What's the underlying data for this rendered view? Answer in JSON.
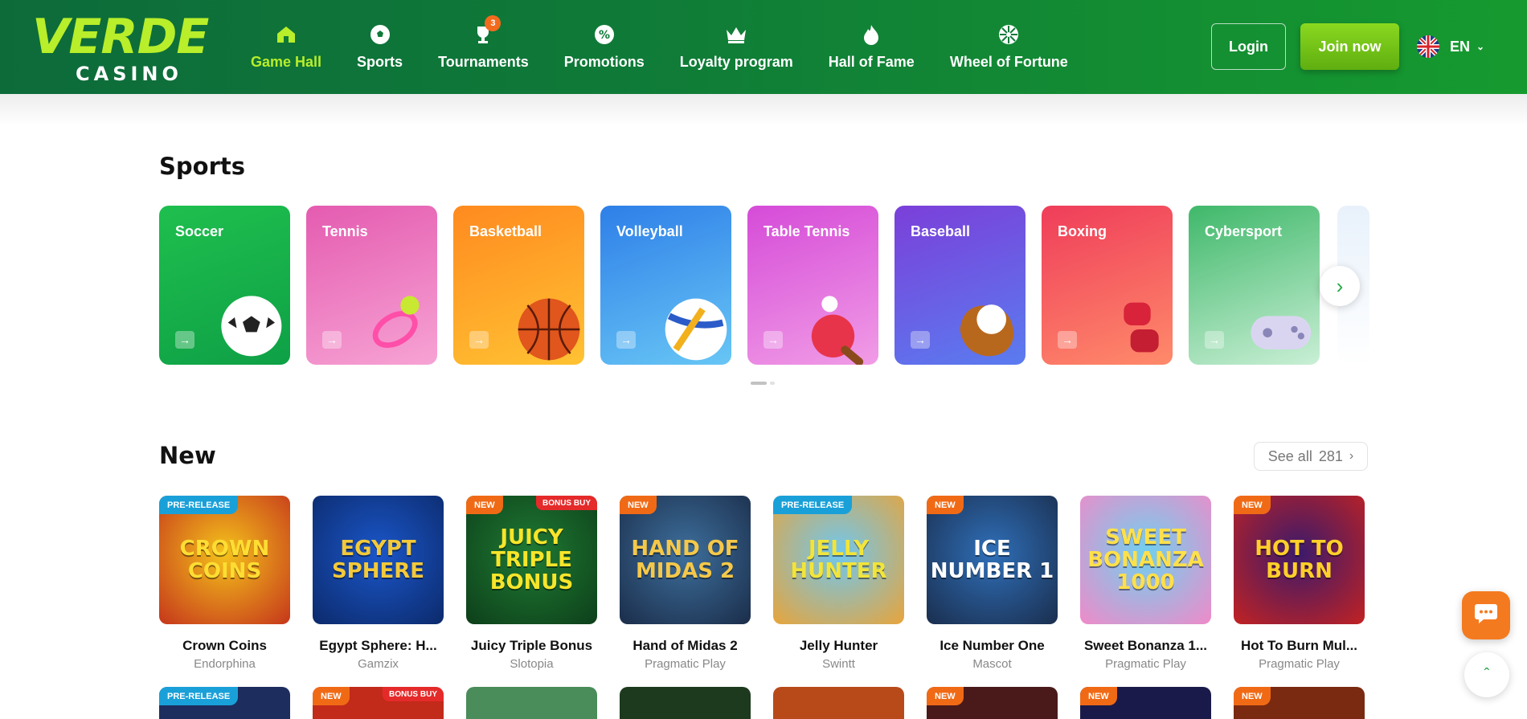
{
  "brand": {
    "name_top": "VERDE",
    "name_bottom": "CASINO"
  },
  "nav": [
    {
      "label": "Game Hall",
      "icon": "home-icon",
      "active": true
    },
    {
      "label": "Sports",
      "icon": "soccer-ball-icon"
    },
    {
      "label": "Tournaments",
      "icon": "trophy-icon",
      "badge": "3"
    },
    {
      "label": "Promotions",
      "icon": "percent-badge-icon"
    },
    {
      "label": "Loyalty program",
      "icon": "crown-icon"
    },
    {
      "label": "Hall of Fame",
      "icon": "flame-icon"
    },
    {
      "label": "Wheel of Fortune",
      "icon": "wheel-icon"
    }
  ],
  "header": {
    "login": "Login",
    "join": "Join now",
    "lang": "EN"
  },
  "sports": {
    "title": "Sports",
    "items": [
      {
        "label": "Soccer",
        "color_from": "#1fbf4e",
        "color_to": "#0ea046"
      },
      {
        "label": "Tennis",
        "color_from": "#e45bb0",
        "color_to": "#f7a3d4"
      },
      {
        "label": "Basketball",
        "color_from": "#ff8a1f",
        "color_to": "#ffc233"
      },
      {
        "label": "Volleyball",
        "color_from": "#2e7fe8",
        "color_to": "#68c6f5"
      },
      {
        "label": "Table Tennis",
        "color_from": "#d54bd8",
        "color_to": "#f19ce6"
      },
      {
        "label": "Baseball",
        "color_from": "#7b3fd9",
        "color_to": "#5a7cf0"
      },
      {
        "label": "Boxing",
        "color_from": "#ef3d5a",
        "color_to": "#ff8a6a"
      },
      {
        "label": "Cybersport",
        "color_from": "#3fb86a",
        "color_to": "#c9efd5"
      }
    ]
  },
  "new": {
    "title": "New",
    "see_all": "See all",
    "count": "281",
    "games": [
      {
        "name": "Crown Coins",
        "provider": "Endorphina",
        "tag": "PRE-RELEASE",
        "thumb": "CROWN COINS",
        "bg1": "#f4c21b",
        "bg2": "#c5361b",
        "fg": "#ffdd33"
      },
      {
        "name": "Egypt Sphere: H...",
        "provider": "Gamzix",
        "tag": "",
        "thumb": "EGYPT SPHERE",
        "bg1": "#1a56c9",
        "bg2": "#0c2a6b",
        "fg": "#f3c93a"
      },
      {
        "name": "Juicy Triple Bonus",
        "provider": "Slotopia",
        "tag": "NEW",
        "bonus": "BONUS BUY",
        "thumb": "JUICY TRIPLE BONUS",
        "bg1": "#1f7a33",
        "bg2": "#0d3f1a",
        "fg": "#f7e52a"
      },
      {
        "name": "Hand of Midas 2",
        "provider": "Pragmatic Play",
        "tag": "NEW",
        "thumb": "HAND OF MIDAS 2",
        "bg1": "#3d6f9c",
        "bg2": "#1b2d4a",
        "fg": "#f5c84a"
      },
      {
        "name": "Jelly Hunter",
        "provider": "Swintt",
        "tag": "PRE-RELEASE",
        "thumb": "JELLY HUNTER",
        "bg1": "#6fc7ef",
        "bg2": "#e8a43a",
        "fg": "#f2e53a"
      },
      {
        "name": "Ice Number One",
        "provider": "Mascot",
        "tag": "NEW",
        "thumb": "ICE NUMBER 1",
        "bg1": "#2f6fb8",
        "bg2": "#1a2e4e",
        "fg": "#ffffff"
      },
      {
        "name": "Sweet Bonanza 1...",
        "provider": "Pragmatic Play",
        "tag": "",
        "thumb": "SWEET BONANZA 1000",
        "bg1": "#6fd0f0",
        "bg2": "#f08ac8",
        "fg": "#ffe04a"
      },
      {
        "name": "Hot To Burn Mul...",
        "provider": "Pragmatic Play",
        "tag": "NEW",
        "thumb": "HOT TO BURN",
        "bg1": "#3b1a6b",
        "bg2": "#c22222",
        "fg": "#ffcf2a"
      }
    ],
    "row2": [
      {
        "tag": "PRE-RELEASE",
        "bg": "#1d2d5e"
      },
      {
        "tag": "NEW",
        "bonus": "BONUS BUY",
        "bg": "#c22a1a"
      },
      {
        "tag": "",
        "bg": "#4a8c5a"
      },
      {
        "tag": "",
        "bg": "#1e3a1e"
      },
      {
        "tag": "",
        "bg": "#b84a1a"
      },
      {
        "tag": "NEW",
        "bg": "#4a1a1a"
      },
      {
        "tag": "NEW",
        "bg": "#1a1a4a"
      },
      {
        "tag": "NEW",
        "bg": "#7a2a10"
      }
    ]
  }
}
